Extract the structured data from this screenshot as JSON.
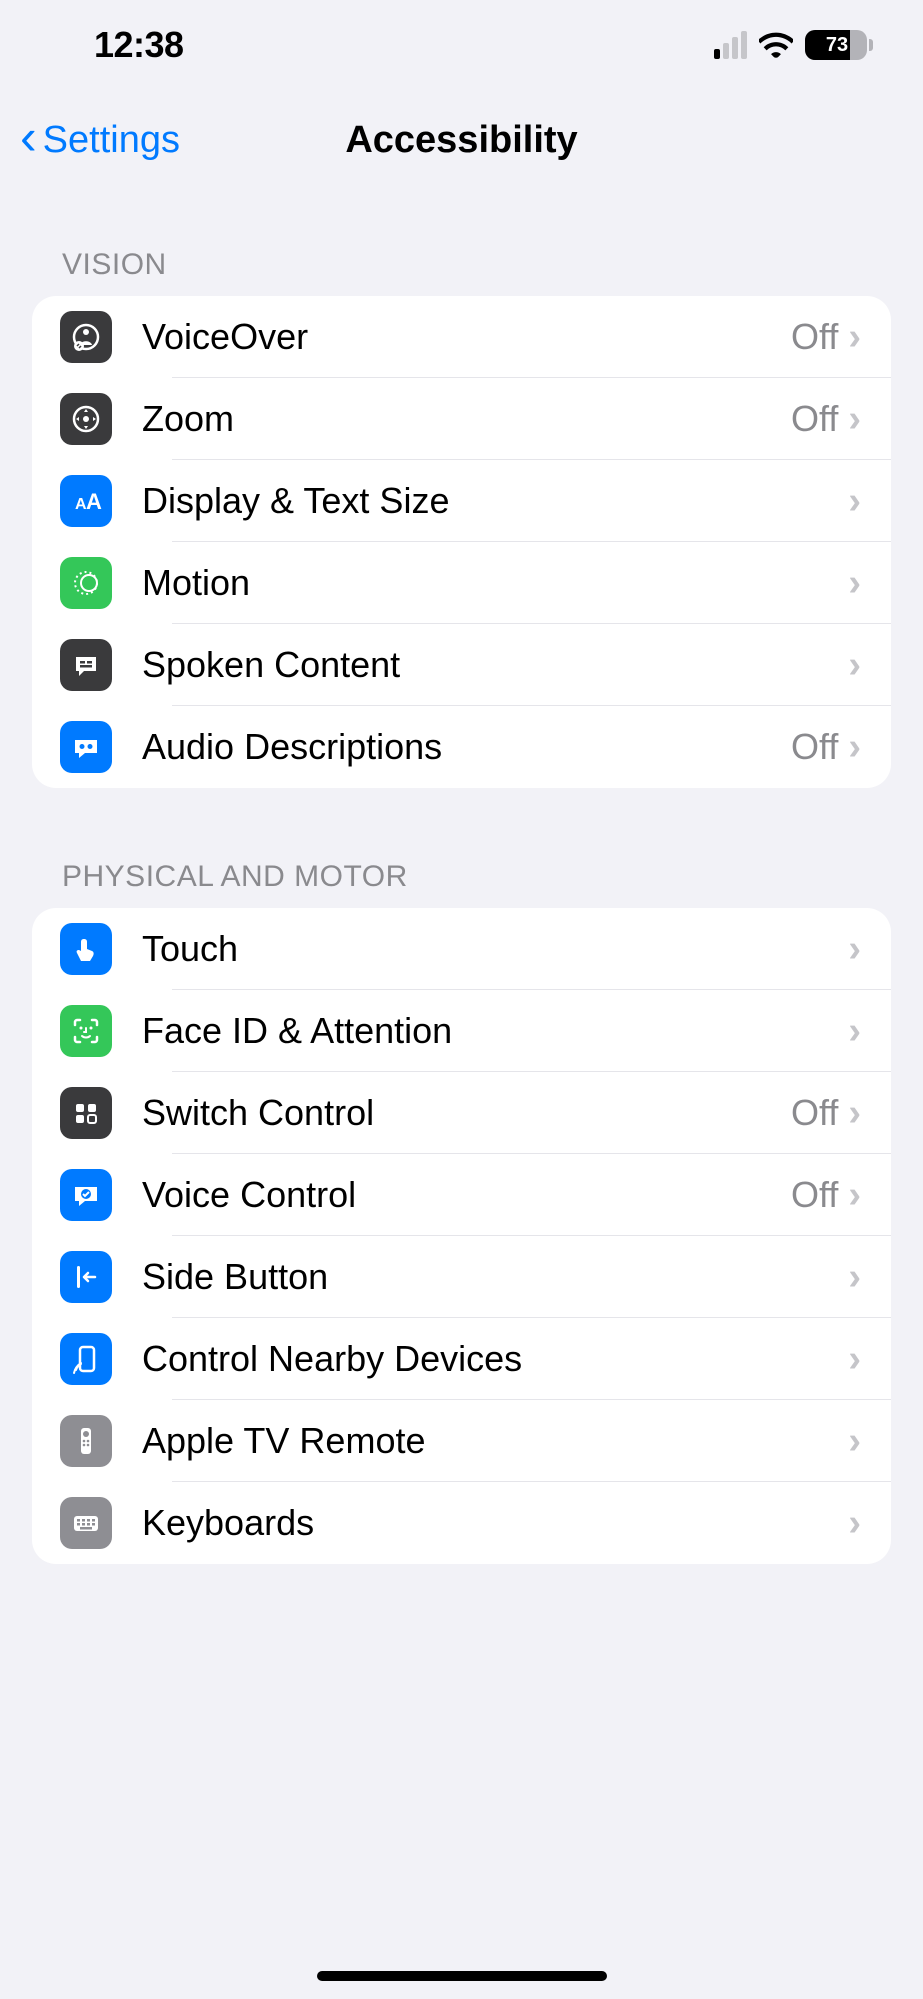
{
  "status": {
    "time": "12:38",
    "battery_pct": "73"
  },
  "nav": {
    "back_label": "Settings",
    "title": "Accessibility"
  },
  "sections": {
    "vision": {
      "header": "VISION",
      "voiceover": {
        "label": "VoiceOver",
        "value": "Off"
      },
      "zoom": {
        "label": "Zoom",
        "value": "Off"
      },
      "display_text_size": {
        "label": "Display & Text Size"
      },
      "motion": {
        "label": "Motion"
      },
      "spoken_content": {
        "label": "Spoken Content"
      },
      "audio_descriptions": {
        "label": "Audio Descriptions",
        "value": "Off"
      }
    },
    "physical": {
      "header": "PHYSICAL AND MOTOR",
      "touch": {
        "label": "Touch"
      },
      "faceid": {
        "label": "Face ID & Attention"
      },
      "switch_control": {
        "label": "Switch Control",
        "value": "Off"
      },
      "voice_control": {
        "label": "Voice Control",
        "value": "Off"
      },
      "side_button": {
        "label": "Side Button"
      },
      "control_nearby": {
        "label": "Control Nearby Devices"
      },
      "apple_tv_remote": {
        "label": "Apple TV Remote"
      },
      "keyboards": {
        "label": "Keyboards"
      }
    }
  }
}
